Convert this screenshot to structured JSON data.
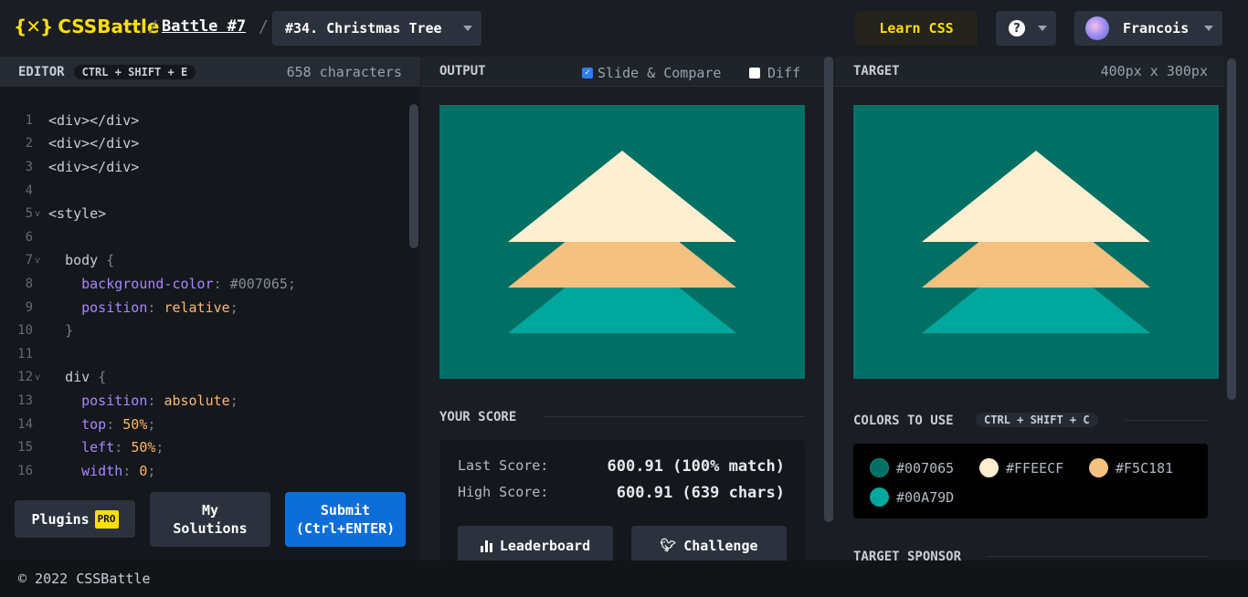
{
  "header": {
    "logo_mark": "{✕}",
    "logo_text": "CSSBattle",
    "separator": "/",
    "battle_link": "Battle #7",
    "challenge_select": "#34. Christmas Tree",
    "learn_css": "Learn CSS",
    "help_glyph": "?",
    "user_name": "Francois"
  },
  "editor": {
    "title": "EDITOR",
    "shortcut": "CTRL + SHIFT + E",
    "char_count": "658 characters",
    "lines": [
      {
        "n": "1",
        "fold": "",
        "html": "<span class='t-tag'>&lt;div&gt;&lt;/div&gt;</span>"
      },
      {
        "n": "2",
        "fold": "",
        "html": "<span class='t-tag'>&lt;div&gt;&lt;/div&gt;</span>"
      },
      {
        "n": "3",
        "fold": "",
        "html": "<span class='t-tag'>&lt;div&gt;&lt;/div&gt;</span>"
      },
      {
        "n": "4",
        "fold": "",
        "html": ""
      },
      {
        "n": "5",
        "fold": "v",
        "html": "<span class='t-tag'>&lt;style&gt;</span>"
      },
      {
        "n": "6",
        "fold": "",
        "html": ""
      },
      {
        "n": "7",
        "fold": "v",
        "html": "  <span class='t-tag'>body</span> <span class='t-punc'>{</span>"
      },
      {
        "n": "8",
        "fold": "",
        "html": "    <span class='t-prop'>background-color</span><span class='t-punc'>:</span> <span class='t-hex'>#007065</span><span class='t-punc'>;</span>"
      },
      {
        "n": "9",
        "fold": "",
        "html": "    <span class='t-prop'>position</span><span class='t-punc'>:</span> <span class='t-val'>relative</span><span class='t-punc'>;</span>"
      },
      {
        "n": "10",
        "fold": "",
        "html": "  <span class='t-punc'>}</span>"
      },
      {
        "n": "11",
        "fold": "",
        "html": ""
      },
      {
        "n": "12",
        "fold": "v",
        "html": "  <span class='t-tag'>div</span> <span class='t-punc'>{</span>"
      },
      {
        "n": "13",
        "fold": "",
        "html": "    <span class='t-prop'>position</span><span class='t-punc'>:</span> <span class='t-val'>absolute</span><span class='t-punc'>;</span>"
      },
      {
        "n": "14",
        "fold": "",
        "html": "    <span class='t-prop'>top</span><span class='t-punc'>:</span> <span class='t-val'>50%</span><span class='t-punc'>;</span>"
      },
      {
        "n": "15",
        "fold": "",
        "html": "    <span class='t-prop'>left</span><span class='t-punc'>:</span> <span class='t-val'>50%</span><span class='t-punc'>;</span>"
      },
      {
        "n": "16",
        "fold": "",
        "html": "    <span class='t-prop'>width</span><span class='t-punc'>:</span> <span class='t-val'>0</span><span class='t-punc'>;</span>"
      }
    ],
    "plugins_label": "Plugins",
    "pro_badge": "PRO",
    "solutions_label_1": "My",
    "solutions_label_2": "Solutions",
    "submit_label_1": "Submit",
    "submit_label_2": "(Ctrl+ENTER)"
  },
  "output": {
    "title": "OUTPUT",
    "slide_compare": "Slide & Compare",
    "slide_compare_checked": true,
    "diff": "Diff",
    "diff_checked": false,
    "score_title": "YOUR SCORE",
    "last_score_label": "Last Score:",
    "last_score_value": "600.91 (100% match)",
    "high_score_label": "High Score:",
    "high_score_value": "600.91 (639 chars)",
    "leaderboard": "Leaderboard",
    "challenge": "Challenge"
  },
  "target": {
    "title": "TARGET",
    "size": "400px x 300px",
    "colors_title": "COLORS TO USE",
    "colors_shortcut": "CTRL + SHIFT + C",
    "colors": [
      {
        "hex": "#007065"
      },
      {
        "hex": "#FFEECF"
      },
      {
        "hex": "#F5C181"
      },
      {
        "hex": "#00A79D"
      }
    ],
    "sponsor_title": "TARGET SPONSOR"
  },
  "footer": {
    "copyright": "© 2022 CSSBattle"
  }
}
